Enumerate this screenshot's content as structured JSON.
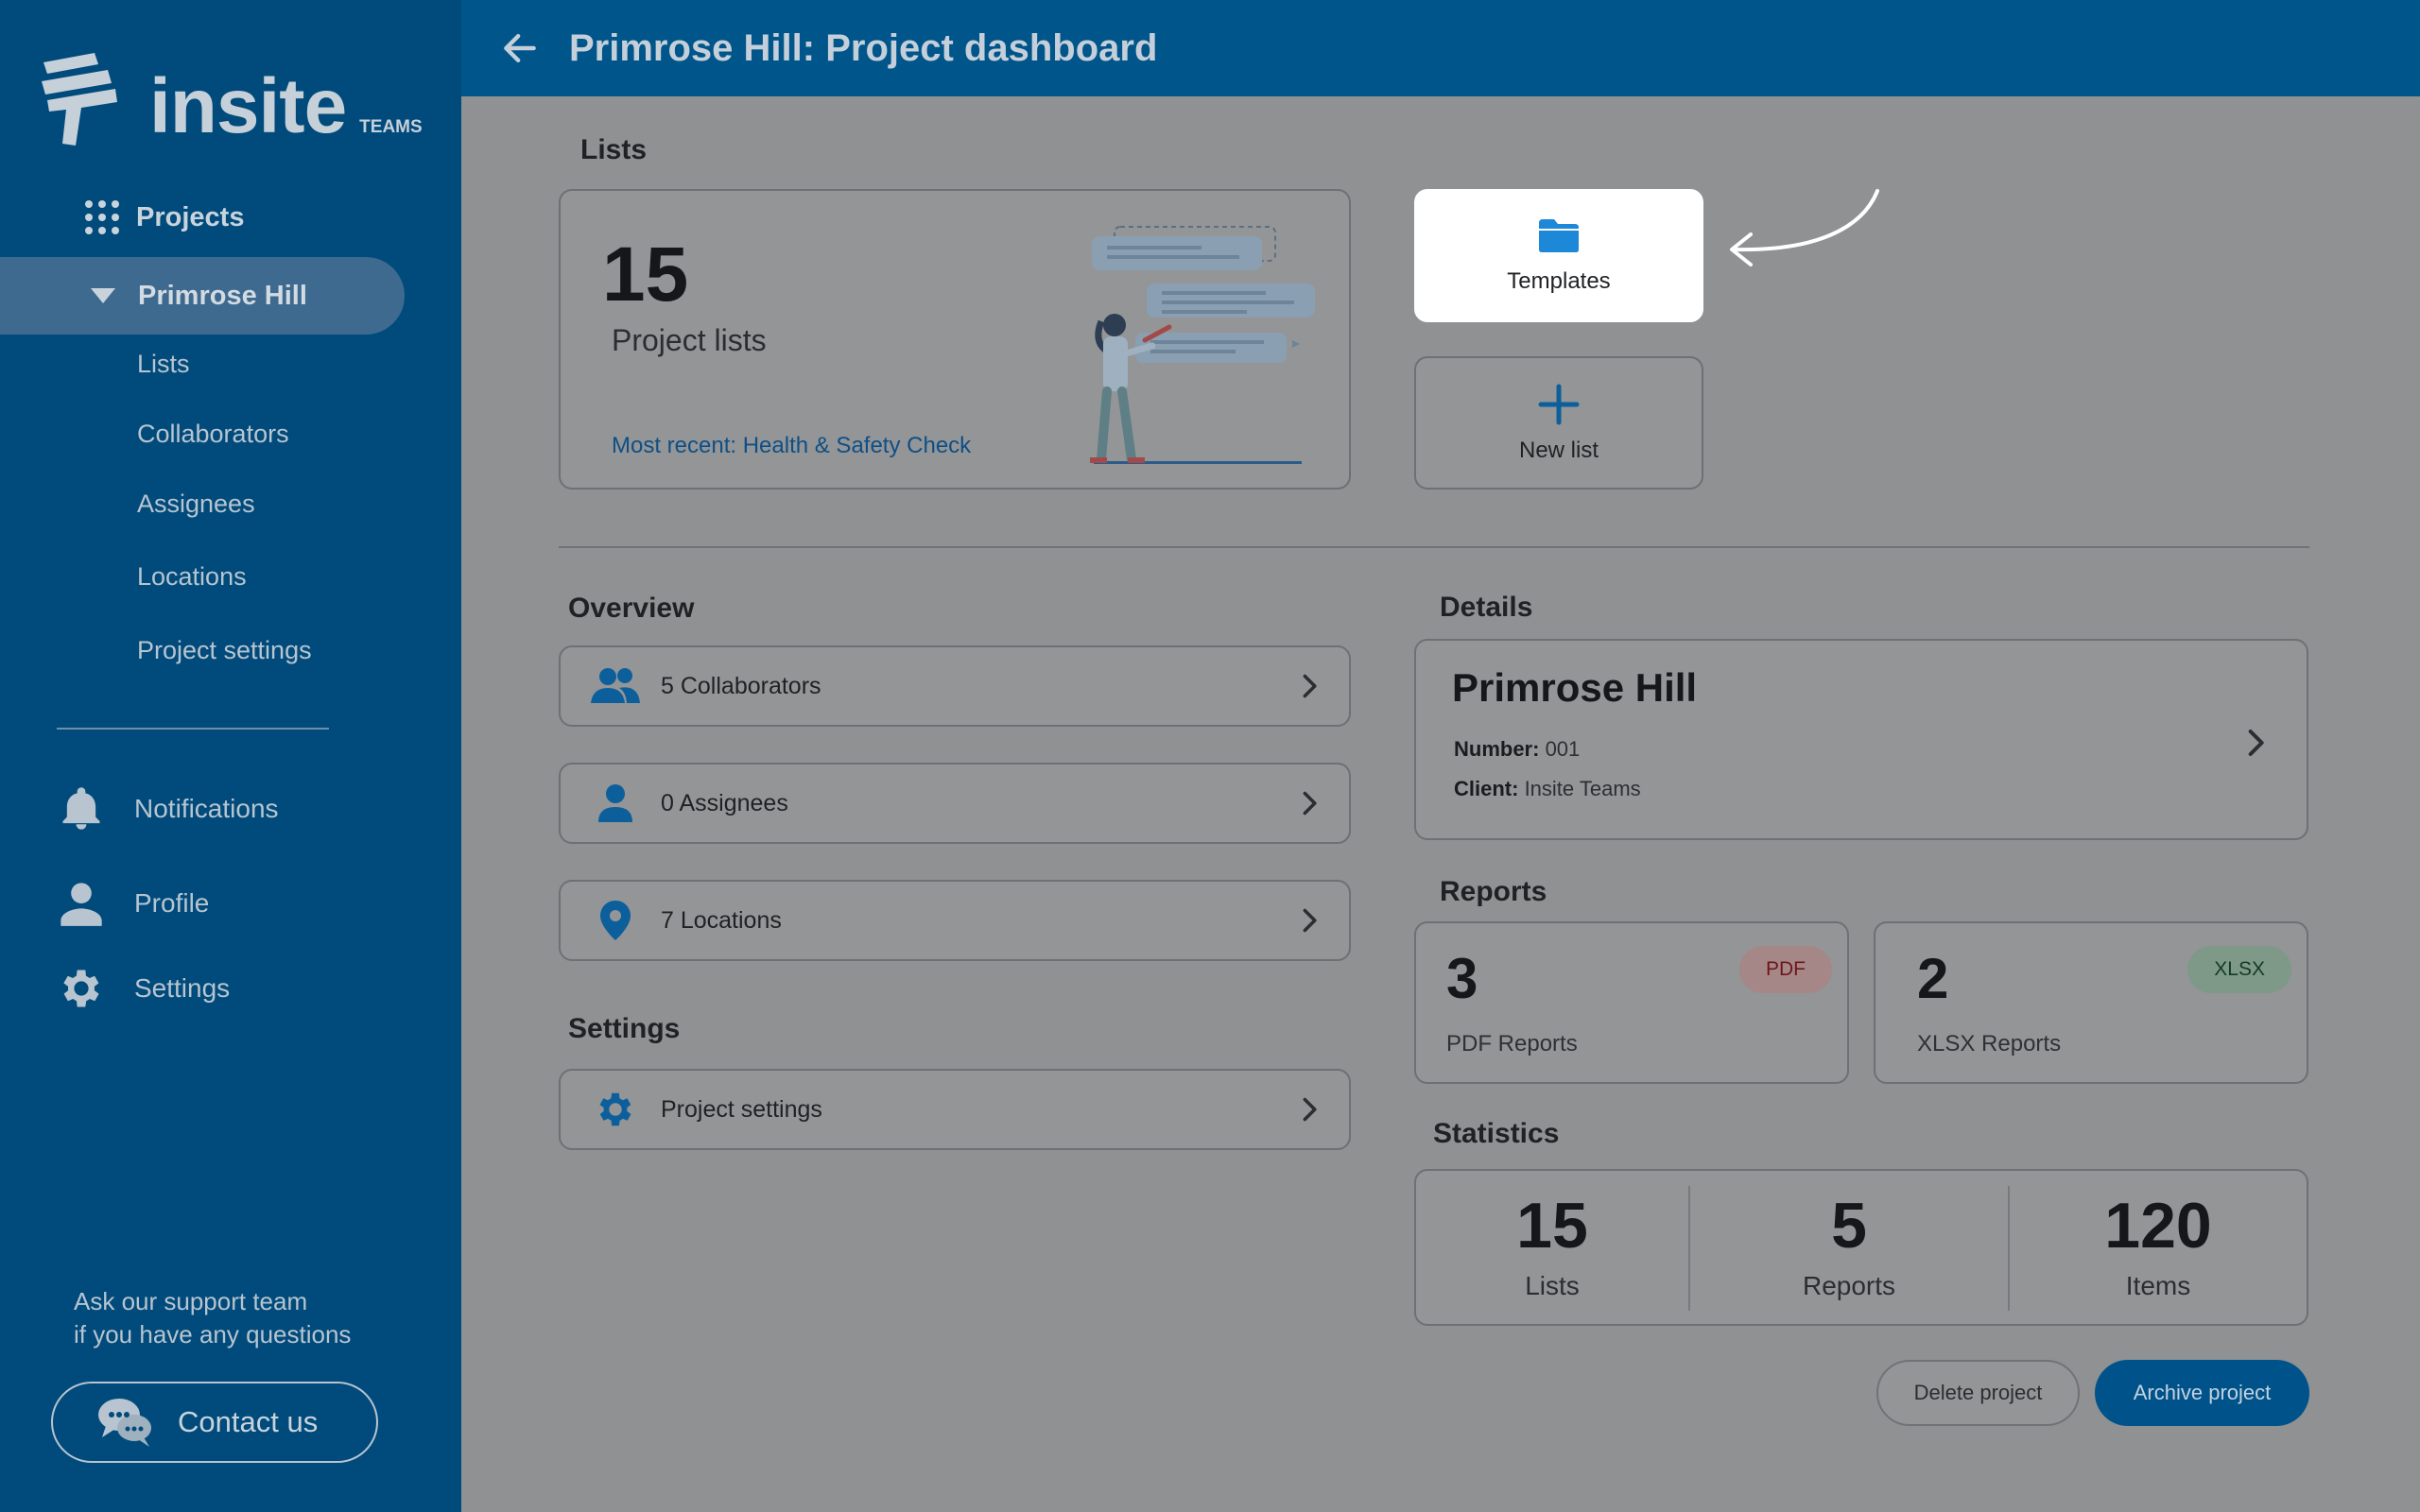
{
  "brand": {
    "name": "insite",
    "sub": "TEAMS"
  },
  "sidebar": {
    "projects_label": "Projects",
    "active_project": "Primrose Hill",
    "sub_items": [
      "Lists",
      "Collaborators",
      "Assignees",
      "Locations",
      "Project settings"
    ],
    "notifications": "Notifications",
    "profile": "Profile",
    "settings": "Settings",
    "support_line1": "Ask our support team",
    "support_line2": "if you have any questions",
    "contact_label": "Contact us"
  },
  "header": {
    "title": "Primrose Hill: Project dashboard"
  },
  "lists": {
    "section": "Lists",
    "count": "15",
    "label": "Project lists",
    "recent": "Most recent: Health & Safety Check",
    "templates_label": "Templates",
    "new_list_label": "New list"
  },
  "overview": {
    "section": "Overview",
    "collaborators": "5 Collaborators",
    "assignees": "0 Assignees",
    "locations": "7 Locations"
  },
  "settings_section": {
    "section": "Settings",
    "project_settings": "Project settings"
  },
  "details": {
    "section": "Details",
    "title": "Primrose Hill",
    "number_label": "Number:",
    "number_value": " 001",
    "client_label": "Client:",
    "client_value": " Insite Teams"
  },
  "reports": {
    "section": "Reports",
    "pdf_count": "3",
    "pdf_label": "PDF Reports",
    "pdf_badge": "PDF",
    "xlsx_count": "2",
    "xlsx_label": "XLSX Reports",
    "xlsx_badge": "XLSX"
  },
  "statistics": {
    "section": "Statistics",
    "lists_n": "15",
    "lists_l": "Lists",
    "reports_n": "5",
    "reports_l": "Reports",
    "items_n": "120",
    "items_l": "Items"
  },
  "actions": {
    "delete": "Delete project",
    "archive": "Archive project"
  },
  "colors": {
    "sidebar": "#004b7c",
    "header": "#00558a",
    "accent": "#1e88d8",
    "overlay": "#8f9192"
  }
}
